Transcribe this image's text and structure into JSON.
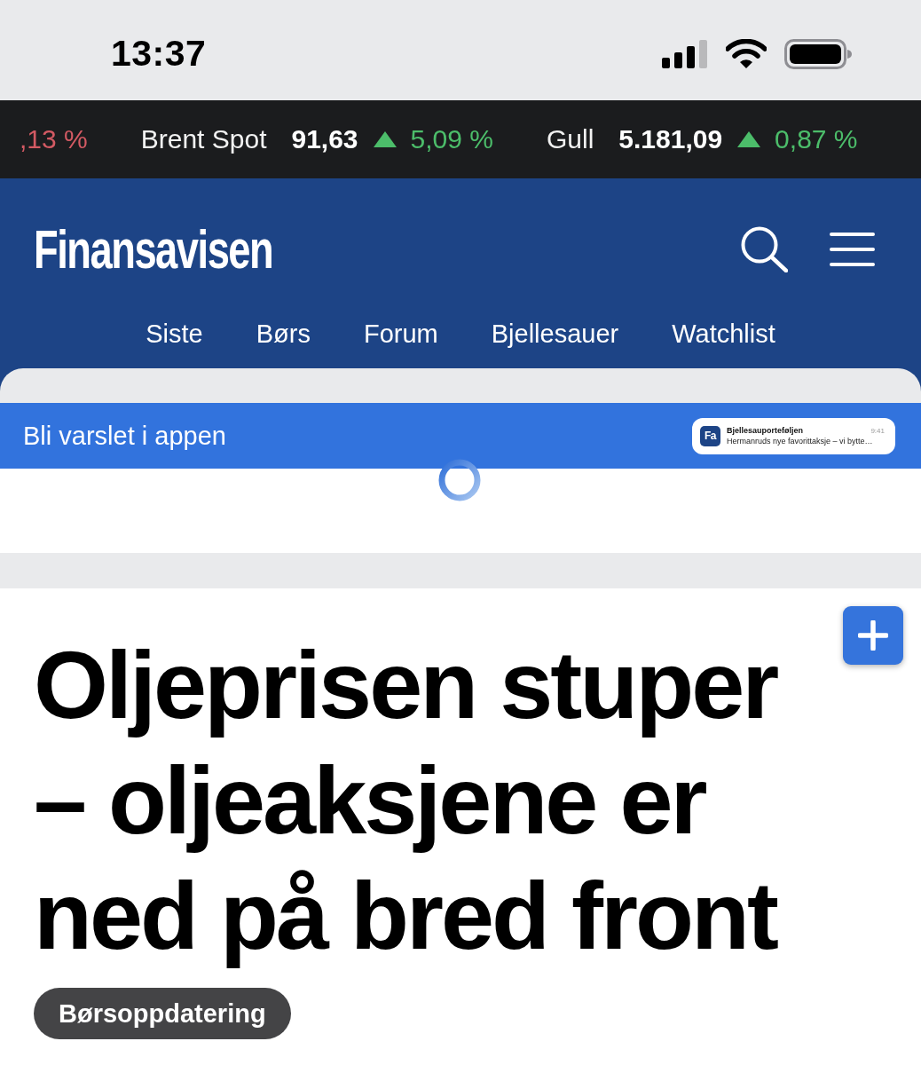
{
  "status_bar": {
    "time": "13:37"
  },
  "ticker": [
    {
      "up": false,
      "change": ",13 %"
    },
    {
      "name": "Brent Spot",
      "price": "91,63",
      "up": true,
      "change": "5,09 %"
    },
    {
      "name": "Gull",
      "price": "5.181,09",
      "up": true,
      "change": "0,87 %"
    }
  ],
  "header": {
    "logo": "Finansavisen",
    "nav": [
      "Siste",
      "Børs",
      "Forum",
      "Bjellesauer",
      "Watchlist"
    ]
  },
  "app_banner": {
    "text": "Bli varslet i appen",
    "notification": {
      "app_icon": "Fa",
      "title": "Bjellesauporteføljen",
      "time": "9:41",
      "message": "Hermanruds nye favorittaksje – vi bytte…"
    }
  },
  "article": {
    "headline": "Oljeprisen stuper – oljeaksjene er ned på bred front",
    "tag": "Børsoppdatering"
  }
}
